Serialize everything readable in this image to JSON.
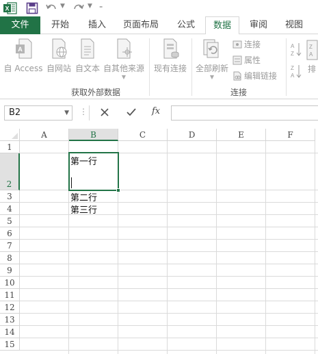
{
  "qat": {
    "app_icon": "excel-logo-icon",
    "save_icon": "save-icon",
    "undo_icon": "undo-icon",
    "redo_icon": "redo-icon",
    "customize_icon": "customize-qat-icon"
  },
  "tabs": {
    "file": "文件",
    "home": "开始",
    "insert": "插入",
    "page_layout": "页面布局",
    "formulas": "公式",
    "data": "数据",
    "review": "审阅",
    "view": "视图"
  },
  "ribbon": {
    "get_external": {
      "access": "自 Access",
      "web": "自网站",
      "text": "自文本",
      "other": "自其他来源",
      "group_label": "获取外部数据"
    },
    "existing_connections": "现有连接",
    "connections": {
      "refresh_all": "全部刷新",
      "connections": "连接",
      "properties": "属性",
      "edit_links": "编辑链接",
      "group_label": "连接"
    },
    "sort_partial": "排"
  },
  "formula_bar": {
    "name_box": "B2",
    "fx": "fx",
    "value": ""
  },
  "grid": {
    "columns": [
      "A",
      "B",
      "C",
      "D",
      "E",
      "F"
    ],
    "rows": [
      "1",
      "2",
      "3",
      "4",
      "5",
      "6",
      "7",
      "8",
      "9",
      "10",
      "11",
      "12",
      "13",
      "14",
      "15"
    ],
    "cells": {
      "B2_line1": "第一行",
      "B3": "第二行",
      "B4": "第三行"
    },
    "active_cell": "B2"
  },
  "colors": {
    "accent": "#217346",
    "header_active_bg": "#e1e1e1",
    "grid_line": "#dadada"
  }
}
